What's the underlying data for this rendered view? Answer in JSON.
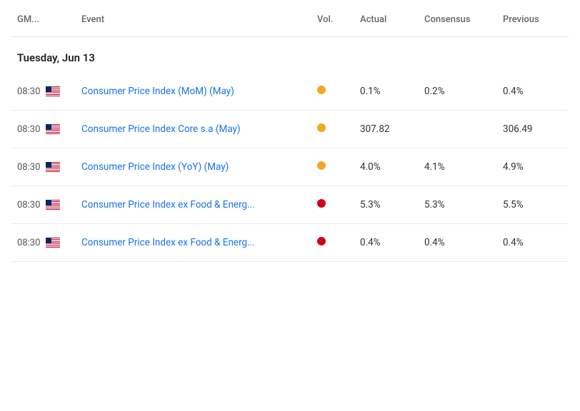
{
  "header": {
    "columns": {
      "gm": "GM...",
      "event": "Event",
      "vol": "Vol.",
      "actual": "Actual",
      "consensus": "Consensus",
      "previous": "Previous"
    }
  },
  "sections": [
    {
      "date": "Tuesday, Jun 13",
      "rows": [
        {
          "time": "08:30",
          "country": "US",
          "event": "Consumer Price Index (MoM) (May)",
          "vol_color": "yellow",
          "actual": "0.1%",
          "consensus": "0.2%",
          "previous": "0.4%"
        },
        {
          "time": "08:30",
          "country": "US",
          "event": "Consumer Price Index Core s.a (May)",
          "vol_color": "yellow",
          "actual": "307.82",
          "consensus": "",
          "previous": "306.49"
        },
        {
          "time": "08:30",
          "country": "US",
          "event": "Consumer Price Index (YoY) (May)",
          "vol_color": "yellow",
          "actual": "4.0%",
          "consensus": "4.1%",
          "previous": "4.9%"
        },
        {
          "time": "08:30",
          "country": "US",
          "event": "Consumer Price Index ex Food & Energ...",
          "vol_color": "red",
          "actual": "5.3%",
          "consensus": "5.3%",
          "previous": "5.5%"
        },
        {
          "time": "08:30",
          "country": "US",
          "event": "Consumer Price Index ex Food & Energ...",
          "vol_color": "red",
          "actual": "0.4%",
          "consensus": "0.4%",
          "previous": "0.4%"
        }
      ]
    }
  ]
}
